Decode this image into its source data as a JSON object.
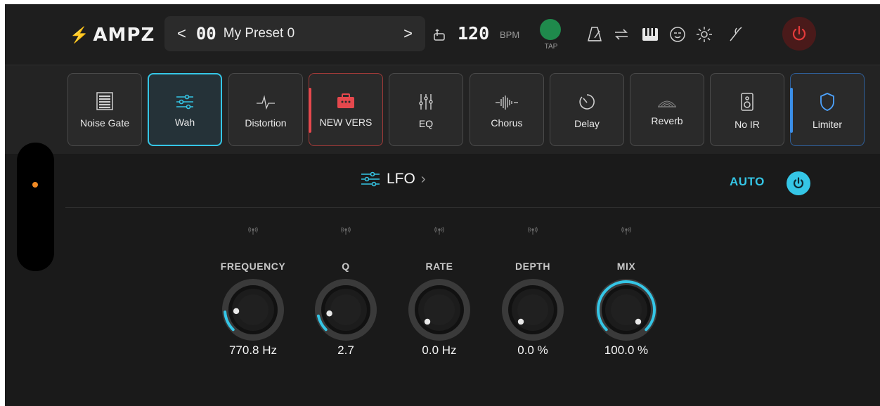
{
  "header": {
    "logo_text": "AMPZ",
    "preset_number": "00",
    "preset_name": "My Preset 0",
    "prev_glyph": "<",
    "next_glyph": ">",
    "bpm_value": "120",
    "bpm_unit": "BPM",
    "tap_label": "TAP",
    "icons": [
      "tap-tempo-icon",
      "metronome-icon",
      "loop-icon",
      "piano-icon",
      "theater-icon",
      "gear-icon",
      "tuner-icon",
      "power-icon"
    ]
  },
  "chain": {
    "slots": [
      {
        "label": "Noise Gate",
        "icon": "noise-gate-icon"
      },
      {
        "label": "Wah",
        "icon": "sliders-icon"
      },
      {
        "label": "Distortion",
        "icon": "waveform-pulse-icon"
      },
      {
        "label": "NEW VERS",
        "icon": "amp-icon"
      },
      {
        "label": "EQ",
        "icon": "eq-icon"
      },
      {
        "label": "Chorus",
        "icon": "wave-icon"
      },
      {
        "label": "Delay",
        "icon": "timer-icon"
      },
      {
        "label": "Reverb",
        "icon": "reverb-icon"
      },
      {
        "label": "No IR",
        "icon": "speaker-icon"
      },
      {
        "label": "Limiter",
        "icon": "shield-icon"
      }
    ]
  },
  "section": {
    "title": "LFO",
    "auto_label": "AUTO"
  },
  "knobs": [
    {
      "label": "FREQUENCY",
      "value": "770.8 Hz",
      "level": 0.15
    },
    {
      "label": "Q",
      "value": "2.7",
      "level": 0.12
    },
    {
      "label": "RATE",
      "value": "0.0 Hz",
      "level": 0.0
    },
    {
      "label": "DEPTH",
      "value": "0.0 %",
      "level": 0.0
    },
    {
      "label": "MIX",
      "value": "100.0 %",
      "level": 1.0
    }
  ],
  "colors": {
    "accent": "#35c6e6",
    "logo_bolt": "#e53b3b",
    "tap_green": "#1f8a4c",
    "indicator_orange": "#f08a24"
  }
}
